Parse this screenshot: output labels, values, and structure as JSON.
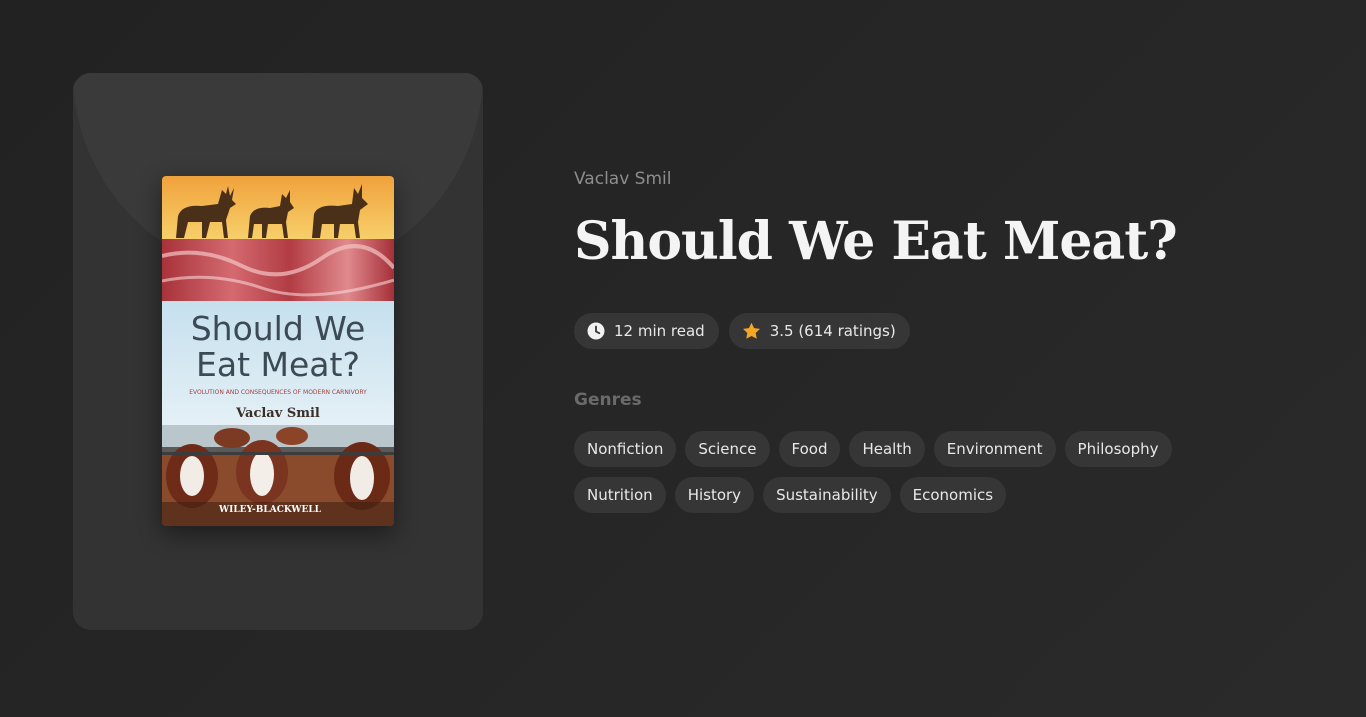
{
  "book": {
    "author": "Vaclav Smil",
    "title": "Should We Eat Meat?",
    "cover": {
      "title_line1": "Should We",
      "title_line2": "Eat Meat?",
      "subtitle": "EVOLUTION AND CONSEQUENCES OF MODERN CARNIVORY",
      "author": "Vaclav Smil",
      "publisher": "WILEY-BLACKWELL"
    }
  },
  "meta": {
    "read_time": "12 min read",
    "rating": "3.5 (614 ratings)",
    "icons": [
      "clock-icon",
      "star-icon"
    ],
    "star_color": "#f5a623"
  },
  "genres": {
    "label": "Genres",
    "items": [
      "Nonfiction",
      "Science",
      "Food",
      "Health",
      "Environment",
      "Philosophy",
      "Nutrition",
      "History",
      "Sustainability",
      "Economics"
    ]
  }
}
